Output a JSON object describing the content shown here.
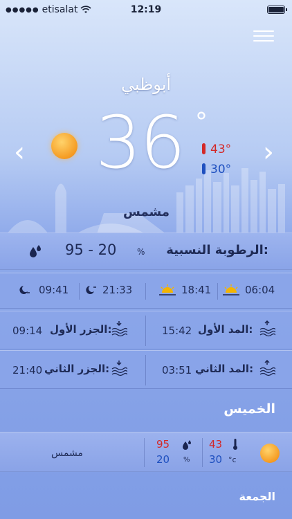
{
  "status_bar": {
    "carrier": "etisalat",
    "time": "12:19",
    "signal_dots": "●●●●●",
    "wifi_icon": "wifi-icon"
  },
  "header": {
    "city": "أبوظبي"
  },
  "current": {
    "temperature": "36",
    "degree_symbol": "°",
    "high": "43°",
    "low": "30°",
    "condition": "مشمس"
  },
  "navigation": {
    "prev_arrow": "‹",
    "next_arrow": "›"
  },
  "humidity": {
    "label": "الرطوبة النسبية:",
    "value": "95 - 20",
    "unit": "%"
  },
  "sun_moon": {
    "sunrise": "06:04",
    "sunset": "18:41",
    "moonrise": "21:33",
    "moonset": "09:41"
  },
  "tides": {
    "high1_label": "المد الأول:",
    "high1_time": "15:42",
    "low1_label": "الجزر الأول:",
    "low1_time": "09:14",
    "high2_label": "المد الثاني:",
    "high2_time": "03:51",
    "low2_label": "الجزر الثاني:",
    "low2_time": "21:40"
  },
  "forecast": [
    {
      "day": "الخميس",
      "condition": "مشمس",
      "temp_high": "43",
      "temp_low": "30",
      "temp_unit": "°c",
      "humidity_high": "95",
      "humidity_low": "20",
      "humidity_unit": "%"
    },
    {
      "day": "الجمعة"
    }
  ],
  "colors": {
    "accent_red": "#d32828",
    "accent_blue": "#1e4fbf",
    "panel": "#8aa4e8"
  }
}
